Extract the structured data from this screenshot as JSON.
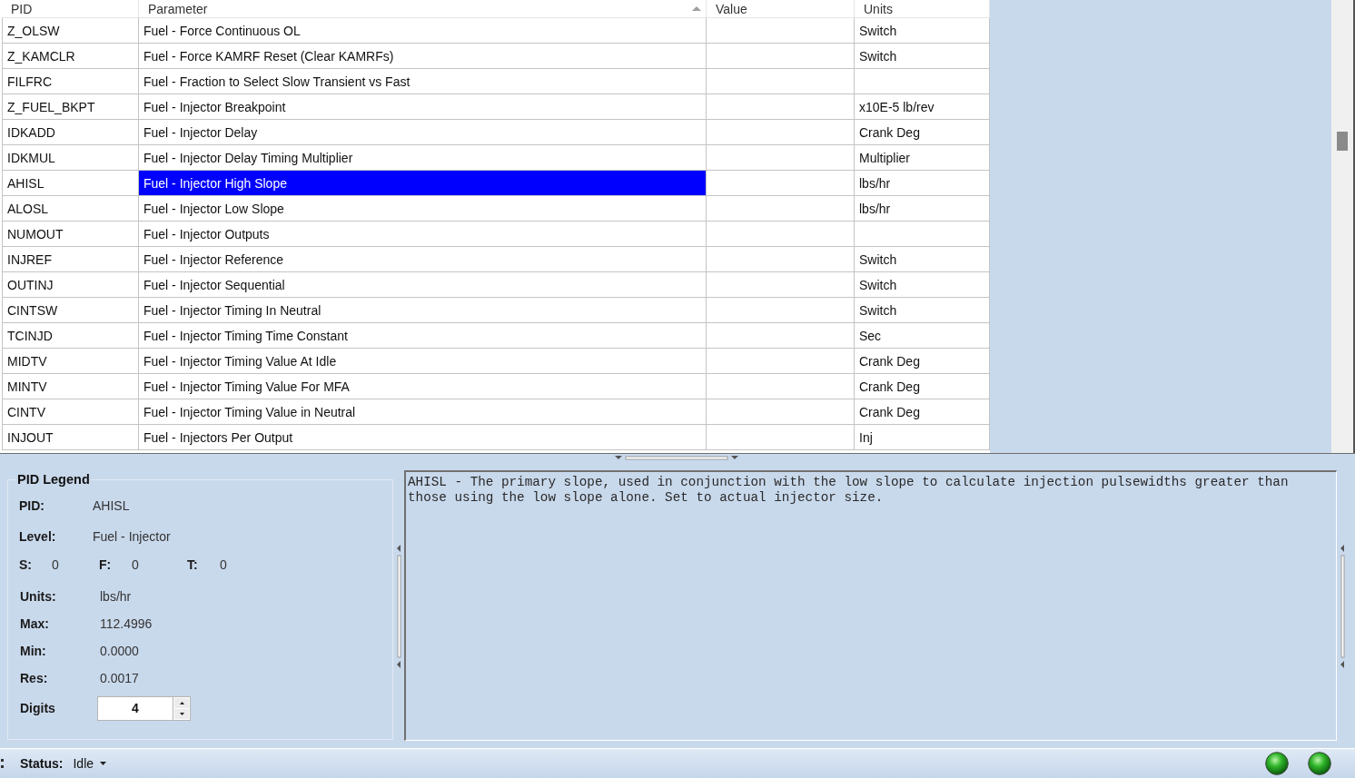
{
  "table": {
    "columns": [
      {
        "label": "PID",
        "sorted": false
      },
      {
        "label": "Parameter",
        "sorted": true
      },
      {
        "label": "Value",
        "sorted": false
      },
      {
        "label": "Units",
        "sorted": false
      }
    ],
    "rows": [
      {
        "pid": "Z_OLSW",
        "parameter": "Fuel - Force Continuous OL",
        "units": "Switch",
        "selected": false
      },
      {
        "pid": "Z_KAMCLR",
        "parameter": "Fuel - Force KAMRF Reset (Clear KAMRFs)",
        "units": "Switch",
        "selected": false
      },
      {
        "pid": "FILFRC",
        "parameter": "Fuel - Fraction to Select Slow Transient vs Fast",
        "selected": false
      },
      {
        "pid": "Z_FUEL_BKPT",
        "parameter": "Fuel - Injector Breakpoint",
        "units": "x10E-5 lb/rev",
        "selected": false
      },
      {
        "pid": "IDKADD",
        "parameter": "Fuel - Injector Delay",
        "units": "Crank Deg",
        "selected": false
      },
      {
        "pid": "IDKMUL",
        "parameter": "Fuel - Injector Delay Timing Multiplier",
        "units": "Multiplier",
        "selected": false
      },
      {
        "pid": "AHISL",
        "parameter": "Fuel - Injector High Slope",
        "units": "lbs/hr",
        "selected": true
      },
      {
        "pid": "ALOSL",
        "parameter": "Fuel - Injector Low Slope",
        "units": "lbs/hr",
        "selected": false
      },
      {
        "pid": "NUMOUT",
        "parameter": "Fuel - Injector Outputs",
        "selected": false
      },
      {
        "pid": "INJREF",
        "parameter": "Fuel - Injector Reference",
        "units": "Switch",
        "selected": false
      },
      {
        "pid": "OUTINJ",
        "parameter": "Fuel - Injector Sequential",
        "units": "Switch",
        "selected": false
      },
      {
        "pid": "CINTSW",
        "parameter": "Fuel - Injector Timing In Neutral",
        "units": "Switch",
        "selected": false
      },
      {
        "pid": "TCINJD",
        "parameter": "Fuel - Injector Timing Time Constant",
        "units": "Sec",
        "selected": false
      },
      {
        "pid": "MIDTV",
        "parameter": "Fuel - Injector Timing Value At Idle",
        "units": "Crank Deg",
        "selected": false
      },
      {
        "pid": "MINTV",
        "parameter": "Fuel - Injector Timing Value For MFA",
        "units": "Crank Deg",
        "selected": false
      },
      {
        "pid": "CINTV",
        "parameter": "Fuel - Injector Timing Value in Neutral",
        "units": "Crank Deg",
        "selected": false
      },
      {
        "pid": "INJOUT",
        "parameter": "Fuel - Injectors Per Output",
        "units": "Inj",
        "selected": false
      }
    ]
  },
  "legend": {
    "title": "PID Legend",
    "info": [
      {
        "label": "PID:",
        "value": "AHISL"
      },
      {
        "label": "Level:",
        "value": "Fuel - Injector"
      }
    ],
    "counters": [
      {
        "label": "S:",
        "value": "0"
      },
      {
        "label": "F:",
        "value": "0"
      },
      {
        "label": "T:",
        "value": "0"
      }
    ],
    "details": [
      {
        "label": "Units:",
        "value": "lbs/hr"
      },
      {
        "label": "Max:",
        "value": "112.4996"
      },
      {
        "label": "Min:",
        "value": "0.0000"
      },
      {
        "label": "Res:",
        "value": "0.0017"
      }
    ],
    "digits": {
      "label": "Digits",
      "value": "4"
    }
  },
  "description": "AHISL - The primary slope, used in conjunction with the low slope to calculate injection pulsewidths greater than those using the low slope alone. Set to actual injector size.",
  "status_bar": {
    "label": "Status:",
    "value": "Idle",
    "lights": [
      {
        "on": true
      },
      {
        "on": true
      }
    ]
  }
}
